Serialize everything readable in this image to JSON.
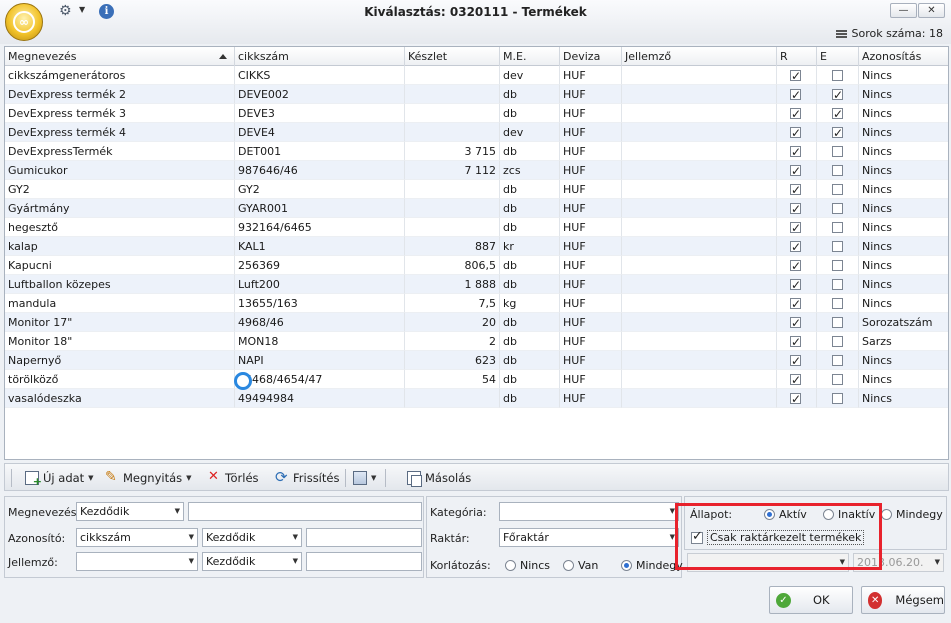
{
  "window": {
    "title": "Kiválasztás: 0320111 - Termékek",
    "minimize": "—",
    "close": "✕",
    "row_count_label": "Sorok száma: 18"
  },
  "grid": {
    "columns": [
      "Megnevezés",
      "cikkszám",
      "Készlet",
      "M.E.",
      "Deviza",
      "Jellemző",
      "R",
      "E",
      "Azonosítás"
    ],
    "rows": [
      {
        "name": "cikkszámgenerátoros",
        "sku": "CIKKS",
        "stock": "",
        "unit": "dev",
        "currency": "HUF",
        "feature": "",
        "r": true,
        "e": false,
        "ident": "Nincs"
      },
      {
        "name": "DevExpress termék 2",
        "sku": "DEVE002",
        "stock": "",
        "unit": "db",
        "currency": "HUF",
        "feature": "",
        "r": true,
        "e": true,
        "ident": "Nincs"
      },
      {
        "name": "DevExpress termék 3",
        "sku": "DEVE3",
        "stock": "",
        "unit": "db",
        "currency": "HUF",
        "feature": "",
        "r": true,
        "e": true,
        "ident": "Nincs"
      },
      {
        "name": "DevExpress termék 4",
        "sku": "DEVE4",
        "stock": "",
        "unit": "dev",
        "currency": "HUF",
        "feature": "",
        "r": true,
        "e": true,
        "ident": "Nincs"
      },
      {
        "name": "DevExpressTermék",
        "sku": "DET001",
        "stock": "3 715",
        "unit": "db",
        "currency": "HUF",
        "feature": "",
        "r": true,
        "e": false,
        "ident": "Nincs"
      },
      {
        "name": "Gumicukor",
        "sku": "987646/46",
        "stock": "7 112",
        "unit": "zcs",
        "currency": "HUF",
        "feature": "",
        "r": true,
        "e": false,
        "ident": "Nincs"
      },
      {
        "name": "GY2",
        "sku": "GY2",
        "stock": "",
        "unit": "db",
        "currency": "HUF",
        "feature": "",
        "r": true,
        "e": false,
        "ident": "Nincs"
      },
      {
        "name": "Gyártmány",
        "sku": "GYAR001",
        "stock": "",
        "unit": "db",
        "currency": "HUF",
        "feature": "",
        "r": true,
        "e": false,
        "ident": "Nincs"
      },
      {
        "name": "hegesztő",
        "sku": "932164/6465",
        "stock": "",
        "unit": "db",
        "currency": "HUF",
        "feature": "",
        "r": true,
        "e": false,
        "ident": "Nincs"
      },
      {
        "name": "kalap",
        "sku": "KAL1",
        "stock": "887",
        "unit": "kr",
        "currency": "HUF",
        "feature": "",
        "r": true,
        "e": false,
        "ident": "Nincs"
      },
      {
        "name": "Kapucni",
        "sku": "256369",
        "stock": "806,5",
        "unit": "db",
        "currency": "HUF",
        "feature": "",
        "r": true,
        "e": false,
        "ident": "Nincs"
      },
      {
        "name": "Luftballon közepes",
        "sku": "Luft200",
        "stock": "1 888",
        "unit": "db",
        "currency": "HUF",
        "feature": "",
        "r": true,
        "e": false,
        "ident": "Nincs"
      },
      {
        "name": "mandula",
        "sku": "13655/163",
        "stock": "7,5",
        "unit": "kg",
        "currency": "HUF",
        "feature": "",
        "r": true,
        "e": false,
        "ident": "Nincs"
      },
      {
        "name": "Monitor 17\"",
        "sku": "4968/46",
        "stock": "20",
        "unit": "db",
        "currency": "HUF",
        "feature": "",
        "r": true,
        "e": false,
        "ident": "Sorozatszám"
      },
      {
        "name": "Monitor 18\"",
        "sku": "MON18",
        "stock": "2",
        "unit": "db",
        "currency": "HUF",
        "feature": "",
        "r": true,
        "e": false,
        "ident": "Sarzs"
      },
      {
        "name": "Napernyő",
        "sku": "NAPI",
        "stock": "623",
        "unit": "db",
        "currency": "HUF",
        "feature": "",
        "r": true,
        "e": false,
        "ident": "Nincs"
      },
      {
        "name": "törölköző",
        "sku": "35468/4654/47",
        "stock": "54",
        "unit": "db",
        "currency": "HUF",
        "feature": "",
        "r": true,
        "e": false,
        "ident": "Nincs"
      },
      {
        "name": "vasalódeszka",
        "sku": "49494984",
        "stock": "",
        "unit": "db",
        "currency": "HUF",
        "feature": "",
        "r": true,
        "e": false,
        "ident": "Nincs"
      }
    ]
  },
  "toolbar": {
    "new": "Új adat",
    "edit": "Megnyitás",
    "delete": "Törlés",
    "refresh": "Frissítés",
    "copy": "Másolás"
  },
  "filters": {
    "name_label": "Megnevezés:",
    "name_mode": "Kezdődik",
    "name_value": "",
    "id_label": "Azonosító:",
    "id_field": "cikkszám",
    "id_mode": "Kezdődik",
    "id_value": "",
    "feature_label": "Jellemző:",
    "feature_field": "",
    "feature_mode": "Kezdődik",
    "feature_value": "",
    "category_label": "Kategória:",
    "category_value": "",
    "warehouse_label": "Raktár:",
    "warehouse_value": "Főraktár",
    "restriction_label": "Korlátozás:",
    "restriction_options": [
      "Nincs",
      "Van",
      "Mindegy"
    ],
    "restriction_selected": 2,
    "state_label": "Állapot:",
    "state_options": [
      "Aktív",
      "Inaktív",
      "Mindegy"
    ],
    "state_selected": 0,
    "stock_managed_label": "Csak raktárkezelt termékek",
    "stock_managed_checked": true,
    "date_value": "2013.06.20."
  },
  "buttons": {
    "ok": "OK",
    "cancel": "Mégsem"
  }
}
